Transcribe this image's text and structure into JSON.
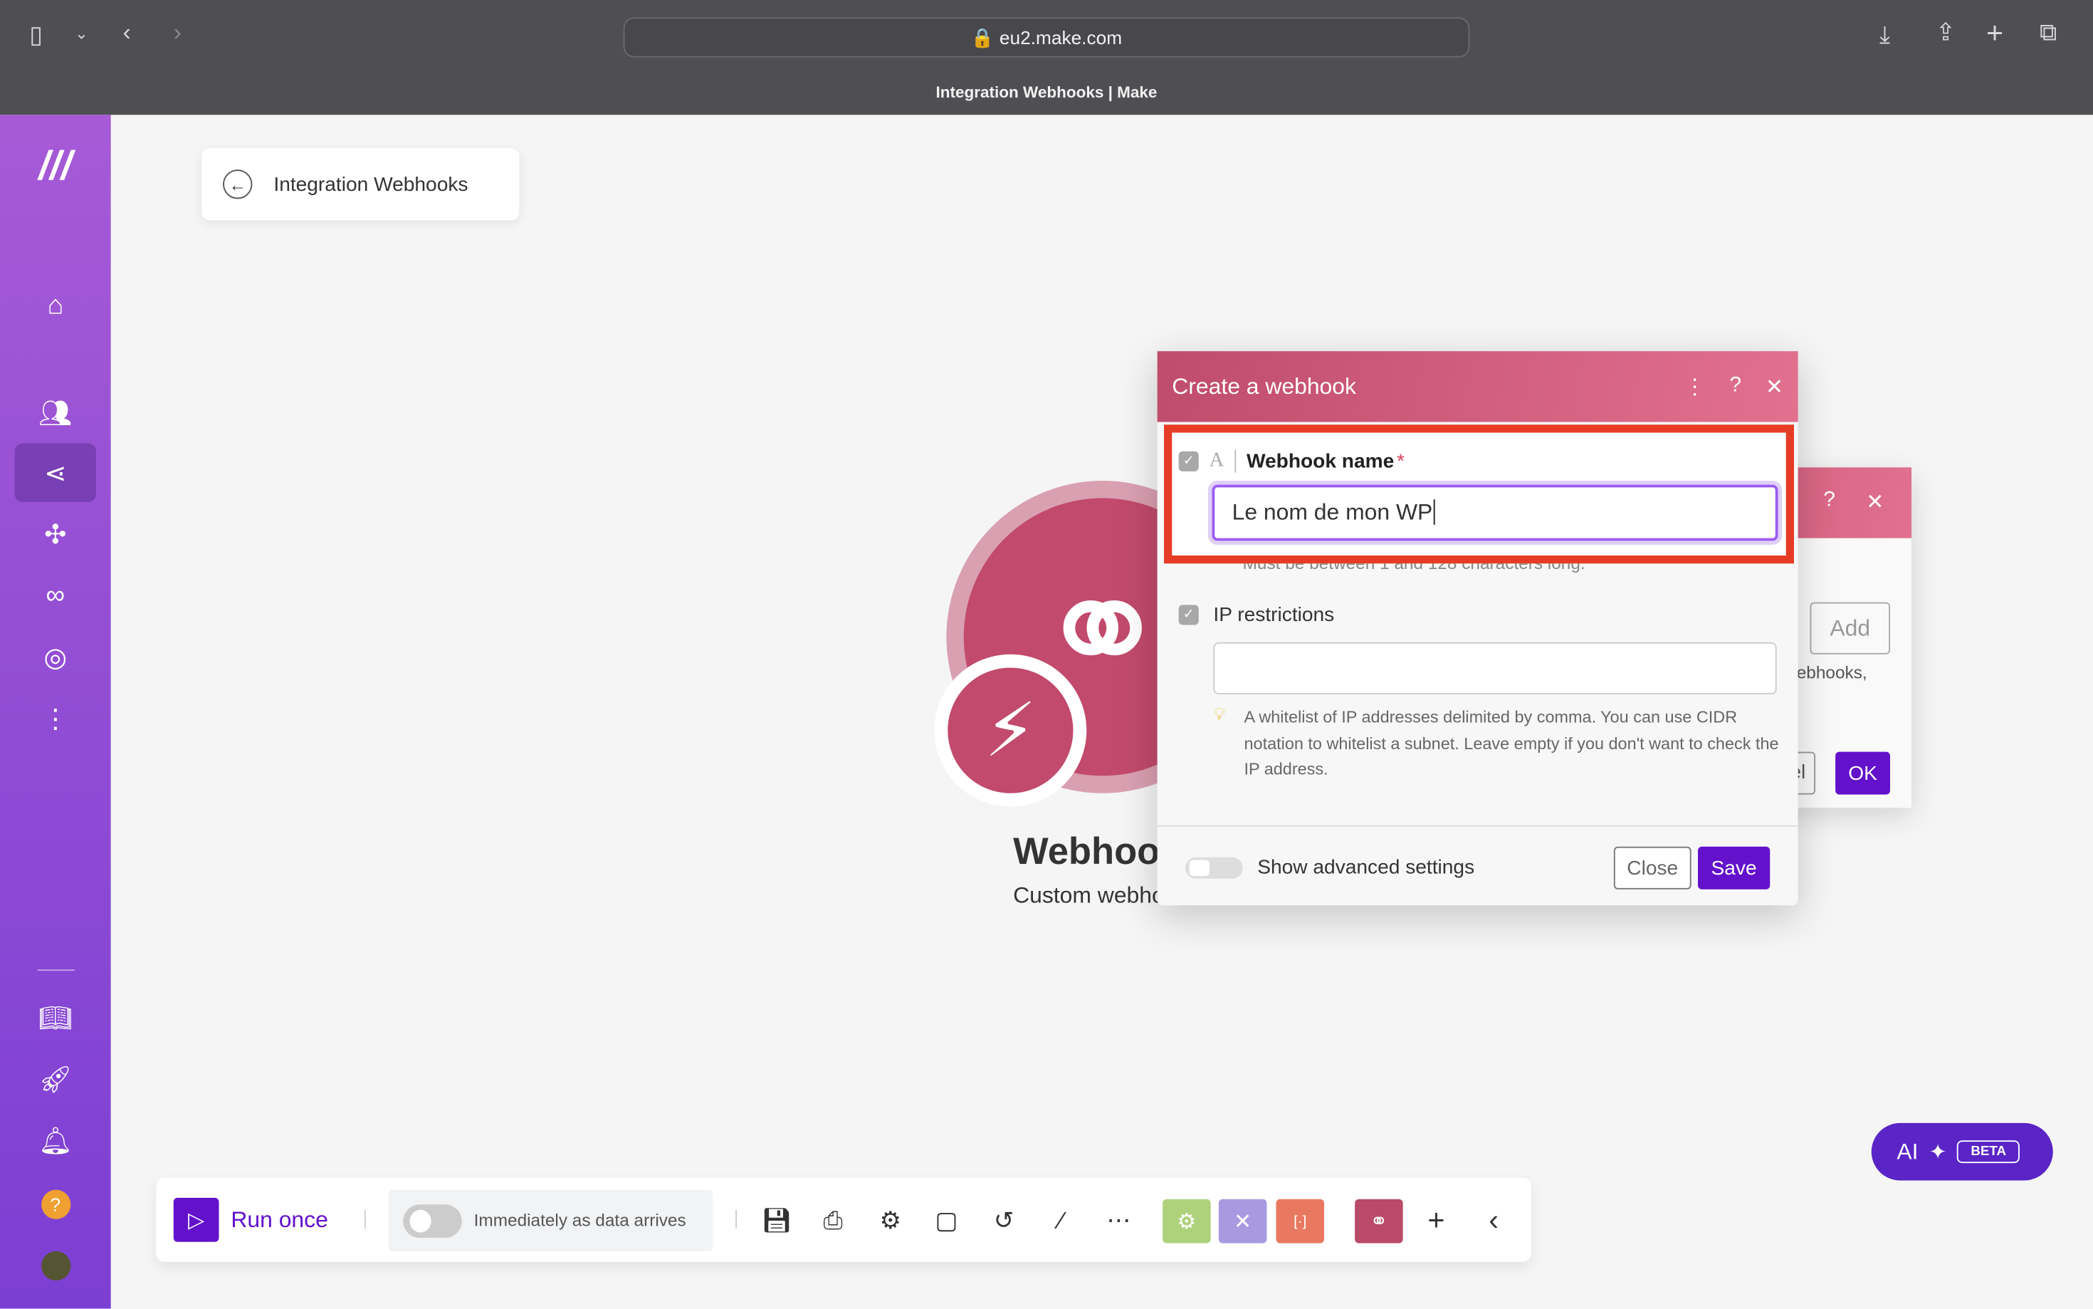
{
  "browser": {
    "url": "eu2.make.com",
    "tab_title": "Integration Webhooks | Make"
  },
  "sidebar": {
    "items": [
      {
        "icon": "home-icon"
      },
      {
        "icon": "team-icon"
      },
      {
        "icon": "scenarios-icon",
        "active": true
      },
      {
        "icon": "puzzle-icon"
      },
      {
        "icon": "link-icon"
      },
      {
        "icon": "globe-icon"
      },
      {
        "icon": "more-icon"
      },
      {
        "icon": "book-icon"
      },
      {
        "icon": "rocket-icon"
      },
      {
        "icon": "bell-icon"
      },
      {
        "icon": "help-icon"
      },
      {
        "icon": "avatar"
      }
    ]
  },
  "header": {
    "back_label": "Integration Webhooks"
  },
  "module": {
    "title": "Webhooks",
    "subtitle": "Custom webhook",
    "color": "#c24a6c"
  },
  "back_dialog": {
    "add_label": "Add",
    "text_fragment": "ebhooks,",
    "cancel_fragment": "el",
    "ok_label": "OK"
  },
  "dialog": {
    "title": "Create a webhook",
    "name_label": "Webhook name",
    "required_mark": "*",
    "name_value": "Le nom de mon WP",
    "name_hint": "Must be between 1 and 128 characters long.",
    "ip_label": "IP restrictions",
    "ip_value": "",
    "ip_hint": "A whitelist of IP addresses delimited by comma. You can use CIDR notation to whitelist a subnet. Leave empty if you don't want to check the IP address.",
    "advanced_label": "Show advanced settings",
    "advanced_on": false,
    "close_label": "Close",
    "save_label": "Save"
  },
  "toolbar": {
    "run_label": "Run once",
    "schedule_label": "Immediately as data arrives",
    "schedule_on": false
  },
  "ai": {
    "label": "AI",
    "badge": "BETA"
  },
  "colors": {
    "accent": "#6311cb",
    "highlight": "#e63c26",
    "module": "#c24a6c"
  }
}
